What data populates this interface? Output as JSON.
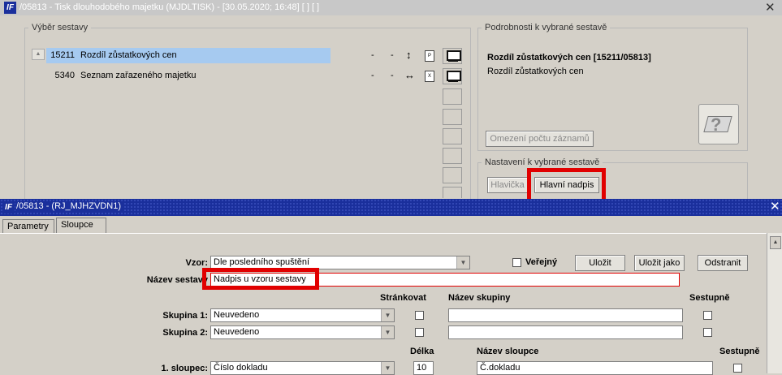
{
  "win1": {
    "title": "/05813 - Tisk dlouhodobého majetku (MJDLTISK) - [30.05.2020; 16:48]  [ ]  [ ]",
    "icon_label": "IF",
    "group_select_title": "Výběr sestavy",
    "reports": [
      {
        "code": "15211",
        "name": "Rozdíl zůstatkových cen",
        "d1": "-",
        "d2": "-",
        "sort": "↕",
        "file": "PDF"
      },
      {
        "code": "5340",
        "name": "Seznam zařazeného majetku",
        "d1": "-",
        "d2": "-",
        "sort": "↔",
        "file": "XLS"
      }
    ],
    "details_title": "Podrobnosti k vybrané sestavě",
    "details_name": "Rozdíl zůstatkových cen [15211/05813]",
    "details_desc": "Rozdíl zůstatkových cen",
    "limit_button": "Omezení počtu záznamů",
    "settings_title": "Nastavení k vybrané sestavě",
    "header_button": "Hlavička",
    "main_title_button": "Hlavní nadpis"
  },
  "win2": {
    "title": "/05813 - (RJ_MJHZVDN1)",
    "tabs": [
      "Parametry",
      "Sloupce"
    ],
    "vzor_label": "Vzor:",
    "vzor_value": "Dle posledního spuštění",
    "public_label": "Veřejný",
    "save_btn": "Uložit",
    "save_as_btn": "Uložit jako",
    "remove_btn": "Odstranit",
    "name_label": "Název sestavy",
    "name_value": "Nadpis u vzoru sestavy",
    "col_pagination": "Stránkovat",
    "col_group_name": "Název skupiny",
    "col_desc": "Sestupně",
    "groups": [
      {
        "label": "Skupina 1:",
        "value": "Neuvedeno"
      },
      {
        "label": "Skupina 2:",
        "value": "Neuvedeno"
      }
    ],
    "col_length": "Délka",
    "col_column_name": "Název sloupce",
    "col_desc2": "Sestupně",
    "column1_label": "1. sloupec:",
    "column1_value": "Číslo dokladu",
    "column1_length": "10",
    "column1_name": "Č.dokladu"
  },
  "colors": {
    "highlight_red": "#e10000",
    "titlebar_blue": "#1a2f9c",
    "selection": "#a6caf0"
  }
}
